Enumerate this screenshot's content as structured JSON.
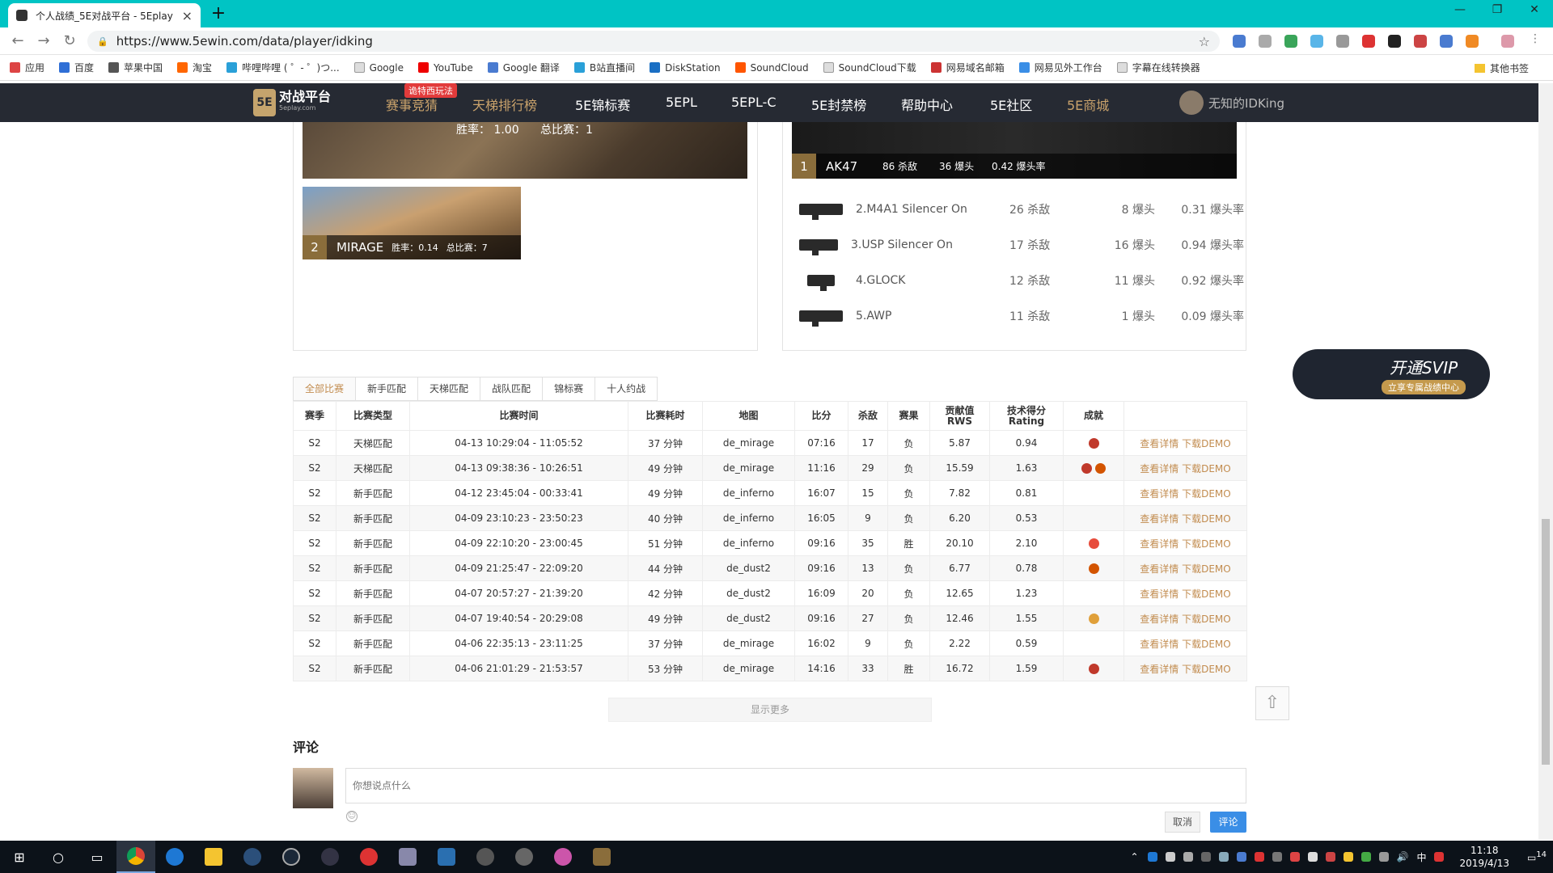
{
  "browser": {
    "tab_title": "个人战绩_5E对战平台 - 5Eplay",
    "url": "https://www.5ewin.com/data/player/idking",
    "bookmarks": [
      "应用",
      "百度",
      "苹果中国",
      "淘宝",
      "哔哩哔哩 ( ゜- ゜)つ...",
      "Google",
      "YouTube",
      "Google 翻译",
      "B站直播间",
      "DiskStation",
      "SoundCloud",
      "SoundCloud下载",
      "网易域名邮箱",
      "网易见外工作台",
      "字幕在线转换器"
    ],
    "other_bookmarks": "其他书签"
  },
  "site": {
    "logo_text": "对战平台",
    "logo_sub": "5eplay.com",
    "logo_badge": "5E",
    "hot_badge": "诡特西玩法",
    "nav": [
      "赛事竞猜",
      "天梯排行榜",
      "5E锦标赛",
      "5EPL",
      "5EPL-C",
      "5E封禁榜",
      "帮助中心",
      "5E社区",
      "5E商城"
    ],
    "user": "无知的IDKing"
  },
  "maps": {
    "top_winrate": "胜率： 1.00",
    "top_total": "总比赛：1",
    "second": {
      "rank": "2",
      "name": "MIRAGE",
      "winrate": "胜率：0.14",
      "total": "总比赛：7"
    }
  },
  "weapons": {
    "top": {
      "rank": "1",
      "name": "AK47",
      "kills": "86 杀敌",
      "hs": "36 爆头",
      "rate": "0.42 爆头率"
    },
    "list": [
      {
        "name": "2.M4A1 Silencer On",
        "kills": "26 杀敌",
        "hs": "8 爆头",
        "rate": "0.31 爆头率"
      },
      {
        "name": "3.USP Silencer On",
        "kills": "17 杀敌",
        "hs": "16 爆头",
        "rate": "0.94 爆头率"
      },
      {
        "name": "4.GLOCK",
        "kills": "12 杀敌",
        "hs": "11 爆头",
        "rate": "0.92 爆头率"
      },
      {
        "name": "5.AWP",
        "kills": "11 杀敌",
        "hs": "1 爆头",
        "rate": "0.09 爆头率"
      }
    ]
  },
  "filters": [
    "全部比赛",
    "新手匹配",
    "天梯匹配",
    "战队匹配",
    "锦标赛",
    "十人约战"
  ],
  "table": {
    "headers": [
      "赛季",
      "比赛类型",
      "比赛时间",
      "比赛耗时",
      "地图",
      "比分",
      "杀敌",
      "赛果",
      "贡献值\nRWS",
      "技术得分\nRating",
      "成就",
      ""
    ],
    "rows": [
      {
        "season": "S2",
        "type": "天梯匹配",
        "time": "04-13 10:29:04 - 11:05:52",
        "dur": "37 分钟",
        "map": "de_mirage",
        "score": "07:16",
        "kills": "17",
        "result": "负",
        "rws": "5.87",
        "rating": "0.94"
      },
      {
        "season": "S2",
        "type": "天梯匹配",
        "time": "04-13 09:38:36 - 10:26:51",
        "dur": "49 分钟",
        "map": "de_mirage",
        "score": "11:16",
        "kills": "29",
        "result": "负",
        "rws": "15.59",
        "rating": "1.63"
      },
      {
        "season": "S2",
        "type": "新手匹配",
        "time": "04-12 23:45:04 - 00:33:41",
        "dur": "49 分钟",
        "map": "de_inferno",
        "score": "16:07",
        "kills": "15",
        "result": "负",
        "rws": "7.82",
        "rating": "0.81"
      },
      {
        "season": "S2",
        "type": "新手匹配",
        "time": "04-09 23:10:23 - 23:50:23",
        "dur": "40 分钟",
        "map": "de_inferno",
        "score": "16:05",
        "kills": "9",
        "result": "负",
        "rws": "6.20",
        "rating": "0.53"
      },
      {
        "season": "S2",
        "type": "新手匹配",
        "time": "04-09 22:10:20 - 23:00:45",
        "dur": "51 分钟",
        "map": "de_inferno",
        "score": "09:16",
        "kills": "35",
        "result": "胜",
        "rws": "20.10",
        "rating": "2.10"
      },
      {
        "season": "S2",
        "type": "新手匹配",
        "time": "04-09 21:25:47 - 22:09:20",
        "dur": "44 分钟",
        "map": "de_dust2",
        "score": "09:16",
        "kills": "13",
        "result": "负",
        "rws": "6.77",
        "rating": "0.78"
      },
      {
        "season": "S2",
        "type": "新手匹配",
        "time": "04-07 20:57:27 - 21:39:20",
        "dur": "42 分钟",
        "map": "de_dust2",
        "score": "16:09",
        "kills": "20",
        "result": "负",
        "rws": "12.65",
        "rating": "1.23"
      },
      {
        "season": "S2",
        "type": "新手匹配",
        "time": "04-07 19:40:54 - 20:29:08",
        "dur": "49 分钟",
        "map": "de_dust2",
        "score": "09:16",
        "kills": "27",
        "result": "负",
        "rws": "12.46",
        "rating": "1.55"
      },
      {
        "season": "S2",
        "type": "新手匹配",
        "time": "04-06 22:35:13 - 23:11:25",
        "dur": "37 分钟",
        "map": "de_mirage",
        "score": "16:02",
        "kills": "9",
        "result": "负",
        "rws": "2.22",
        "rating": "0.59"
      },
      {
        "season": "S2",
        "type": "新手匹配",
        "time": "04-06 21:01:29 - 21:53:57",
        "dur": "53 分钟",
        "map": "de_mirage",
        "score": "14:16",
        "kills": "33",
        "result": "胜",
        "rws": "16.72",
        "rating": "1.59"
      }
    ],
    "detail_label": "查看详情",
    "demo_label": "下载DEMO"
  },
  "show_more": "显示更多",
  "svip": {
    "title": "开通SVIP",
    "sub": "立享专属战绩中心"
  },
  "comments": {
    "title": "评论",
    "placeholder": "你想说点什么",
    "cancel": "取消",
    "submit": "评论"
  },
  "taskbar": {
    "time": "11:18",
    "date": "2019/4/13",
    "notif": "14",
    "ime": "中"
  }
}
